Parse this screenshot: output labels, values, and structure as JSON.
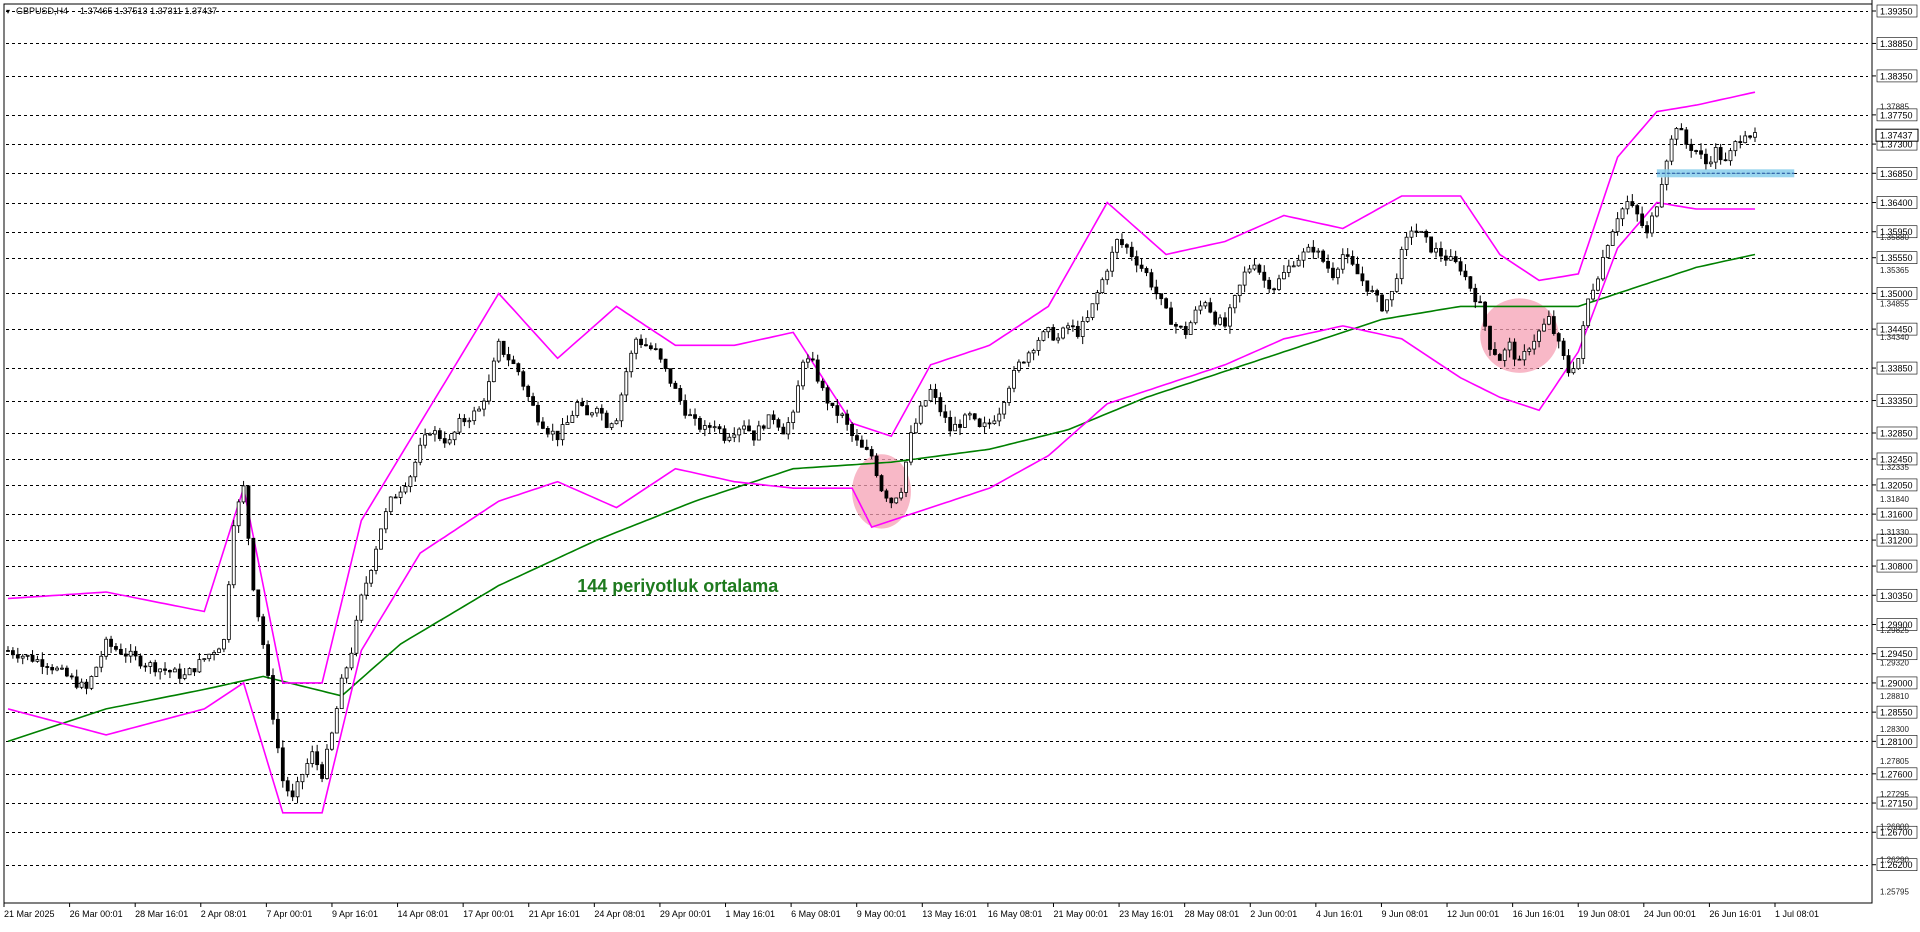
{
  "header": {
    "symbol": "GBPUSD,H4",
    "ohlc": "1.37465 1.37513 1.37311 1.37437"
  },
  "annotation": {
    "ma_label": "144 periyotluk ortalama"
  },
  "colors": {
    "candle": "#000000",
    "bands": "#ff00ff",
    "moving_average": "#008000",
    "highlight_zone": "#f5a0b4",
    "resistance_marker": "#87ceeb",
    "grid": "#000000"
  },
  "chart_data": {
    "type": "candlestick",
    "symbol": "GBPUSD",
    "timeframe": "H4",
    "ylim": [
      1.25795,
      1.3938
    ],
    "price_levels": [
      1.3935,
      1.3885,
      1.3835,
      1.3775,
      1.373,
      1.3685,
      1.364,
      1.3595,
      1.3555,
      1.35,
      1.3445,
      1.3385,
      1.3335,
      1.3285,
      1.3245,
      1.3205,
      1.316,
      1.312,
      1.308,
      1.3035,
      1.299,
      1.2945,
      1.29,
      1.2855,
      1.281,
      1.276,
      1.2715,
      1.267,
      1.262
    ],
    "small_tick_labels": [
      {
        "value": 1.37885,
        "label": "1.37885"
      },
      {
        "value": 1.3588,
        "label": "1.35880"
      },
      {
        "value": 1.35365,
        "label": "1.35365"
      },
      {
        "value": 1.34855,
        "label": "1.34855"
      },
      {
        "value": 1.3434,
        "label": "1.34340"
      },
      {
        "value": 1.32335,
        "label": "1.32335"
      },
      {
        "value": 1.3184,
        "label": "1.31840"
      },
      {
        "value": 1.3133,
        "label": "1.31330"
      },
      {
        "value": 1.29825,
        "label": "1.29825"
      },
      {
        "value": 1.2932,
        "label": "1.29320"
      },
      {
        "value": 1.2881,
        "label": "1.28810"
      },
      {
        "value": 1.283,
        "label": "1.28300"
      },
      {
        "value": 1.27805,
        "label": "1.27805"
      },
      {
        "value": 1.27295,
        "label": "1.27295"
      },
      {
        "value": 1.268,
        "label": "1.26800"
      },
      {
        "value": 1.2629,
        "label": "1.26290"
      },
      {
        "value": 1.25795,
        "label": "1.25795"
      }
    ],
    "current_price": 1.37437,
    "current_price_label": "1.37437",
    "x_labels": [
      "21 Mar 2025",
      "26 Mar 00:01",
      "28 Mar 16:01",
      "2 Apr 08:01",
      "7 Apr 00:01",
      "9 Apr 16:01",
      "14 Apr 08:01",
      "17 Apr 00:01",
      "21 Apr 16:01",
      "24 Apr 08:01",
      "29 Apr 00:01",
      "1 May 16:01",
      "6 May 08:01",
      "9 May 00:01",
      "13 May 16:01",
      "16 May 08:01",
      "21 May 00:01",
      "23 May 16:01",
      "28 May 08:01",
      "2 Jun 00:01",
      "4 Jun 16:01",
      "9 Jun 08:01",
      "12 Jun 00:01",
      "16 Jun 16:01",
      "19 Jun 08:01",
      "24 Jun 00:01",
      "26 Jun 16:01",
      "1 Jul 08:01"
    ],
    "price_path": [
      [
        0,
        1.295
      ],
      [
        4,
        1.293
      ],
      [
        8,
        1.289
      ],
      [
        10,
        1.296
      ],
      [
        14,
        1.293
      ],
      [
        18,
        1.291
      ],
      [
        22,
        1.2965
      ],
      [
        23,
        1.315
      ],
      [
        24,
        1.32
      ],
      [
        25,
        1.305
      ],
      [
        26,
        1.296
      ],
      [
        27,
        1.285
      ],
      [
        28,
        1.275
      ],
      [
        29,
        1.272
      ],
      [
        30,
        1.276
      ],
      [
        31,
        1.279
      ],
      [
        32,
        1.276
      ],
      [
        33,
        1.282
      ],
      [
        34,
        1.29
      ],
      [
        35,
        1.295
      ],
      [
        36,
        1.303
      ],
      [
        37,
        1.308
      ],
      [
        38,
        1.314
      ],
      [
        39,
        1.318
      ],
      [
        40,
        1.32
      ],
      [
        41,
        1.322
      ],
      [
        42,
        1.326
      ],
      [
        43,
        1.329
      ],
      [
        44,
        1.328
      ],
      [
        45,
        1.327
      ],
      [
        46,
        1.33
      ],
      [
        47,
        1.331
      ],
      [
        48,
        1.332
      ],
      [
        49,
        1.336
      ],
      [
        50,
        1.342
      ],
      [
        51,
        1.34
      ],
      [
        52,
        1.338
      ],
      [
        53,
        1.334
      ],
      [
        54,
        1.331
      ],
      [
        55,
        1.329
      ],
      [
        56,
        1.328
      ],
      [
        57,
        1.33
      ],
      [
        58,
        1.333
      ],
      [
        59,
        1.331
      ],
      [
        60,
        1.333
      ],
      [
        61,
        1.33
      ],
      [
        62,
        1.331
      ],
      [
        63,
        1.338
      ],
      [
        64,
        1.343
      ],
      [
        65,
        1.342
      ],
      [
        66,
        1.341
      ],
      [
        67,
        1.338
      ],
      [
        68,
        1.335
      ],
      [
        69,
        1.332
      ],
      [
        70,
        1.33
      ],
      [
        71,
        1.329
      ],
      [
        72,
        1.33
      ],
      [
        73,
        1.328
      ],
      [
        74,
        1.329
      ],
      [
        75,
        1.33
      ],
      [
        76,
        1.328
      ],
      [
        77,
        1.33
      ],
      [
        78,
        1.331
      ],
      [
        79,
        1.329
      ],
      [
        80,
        1.331
      ],
      [
        81,
        1.34
      ],
      [
        82,
        1.339
      ],
      [
        83,
        1.335
      ],
      [
        84,
        1.332
      ],
      [
        85,
        1.331
      ],
      [
        86,
        1.328
      ],
      [
        87,
        1.326
      ],
      [
        88,
        1.325
      ],
      [
        89,
        1.32
      ],
      [
        90,
        1.318
      ],
      [
        91,
        1.32
      ],
      [
        92,
        1.328
      ],
      [
        93,
        1.332
      ],
      [
        94,
        1.335
      ],
      [
        95,
        1.332
      ],
      [
        96,
        1.329
      ],
      [
        97,
        1.33
      ],
      [
        98,
        1.331
      ],
      [
        99,
        1.329
      ],
      [
        100,
        1.33
      ],
      [
        101,
        1.332
      ],
      [
        102,
        1.336
      ],
      [
        103,
        1.339
      ],
      [
        104,
        1.341
      ],
      [
        105,
        1.343
      ],
      [
        106,
        1.344
      ],
      [
        107,
        1.343
      ],
      [
        108,
        1.345
      ],
      [
        109,
        1.344
      ],
      [
        110,
        1.346
      ],
      [
        111,
        1.35
      ],
      [
        112,
        1.354
      ],
      [
        113,
        1.358
      ],
      [
        114,
        1.357
      ],
      [
        115,
        1.355
      ],
      [
        116,
        1.353
      ],
      [
        117,
        1.35
      ],
      [
        118,
        1.347
      ],
      [
        119,
        1.345
      ],
      [
        120,
        1.344
      ],
      [
        121,
        1.347
      ],
      [
        122,
        1.349
      ],
      [
        123,
        1.346
      ],
      [
        124,
        1.345
      ],
      [
        125,
        1.349
      ],
      [
        126,
        1.353
      ],
      [
        127,
        1.355
      ],
      [
        128,
        1.352
      ],
      [
        129,
        1.351
      ],
      [
        130,
        1.353
      ],
      [
        131,
        1.355
      ],
      [
        132,
        1.356
      ],
      [
        133,
        1.357
      ],
      [
        134,
        1.355
      ],
      [
        135,
        1.353
      ],
      [
        136,
        1.356
      ],
      [
        137,
        1.354
      ],
      [
        138,
        1.352
      ],
      [
        139,
        1.35
      ],
      [
        140,
        1.348
      ],
      [
        141,
        1.35
      ],
      [
        142,
        1.356
      ],
      [
        143,
        1.36
      ],
      [
        144,
        1.359
      ],
      [
        145,
        1.357
      ],
      [
        146,
        1.356
      ],
      [
        147,
        1.355
      ],
      [
        148,
        1.354
      ],
      [
        149,
        1.351
      ],
      [
        150,
        1.348
      ],
      [
        151,
        1.342
      ],
      [
        152,
        1.34
      ],
      [
        153,
        1.342
      ],
      [
        154,
        1.339
      ],
      [
        155,
        1.342
      ],
      [
        156,
        1.344
      ],
      [
        157,
        1.346
      ],
      [
        158,
        1.342
      ],
      [
        159,
        1.338
      ],
      [
        160,
        1.34
      ],
      [
        161,
        1.349
      ],
      [
        162,
        1.353
      ],
      [
        163,
        1.358
      ],
      [
        164,
        1.362
      ],
      [
        165,
        1.364
      ],
      [
        166,
        1.362
      ],
      [
        167,
        1.359
      ],
      [
        168,
        1.364
      ],
      [
        169,
        1.371
      ],
      [
        170,
        1.376
      ],
      [
        171,
        1.373
      ],
      [
        172,
        1.372
      ],
      [
        173,
        1.37
      ],
      [
        174,
        1.372
      ],
      [
        175,
        1.37
      ],
      [
        176,
        1.373
      ],
      [
        177,
        1.375
      ],
      [
        178,
        1.374
      ]
    ],
    "price_path_note": "",
    "moving_average": {
      "name": "",
      "points": [
        [
          0,
          1.281
        ],
        [
          10,
          1.286
        ],
        [
          20,
          1.289
        ],
        [
          26,
          1.291
        ],
        [
          34,
          1.288
        ],
        [
          40,
          1.296
        ],
        [
          50,
          1.305
        ],
        [
          60,
          1.312
        ],
        [
          70,
          1.318
        ],
        [
          80,
          1.323
        ],
        [
          90,
          1.324
        ],
        [
          100,
          1.326
        ],
        [
          108,
          1.329
        ],
        [
          116,
          1.334
        ],
        [
          124,
          1.338
        ],
        [
          132,
          1.342
        ],
        [
          140,
          1.346
        ],
        [
          148,
          1.348
        ],
        [
          154,
          1.348
        ],
        [
          160,
          1.348
        ],
        [
          166,
          1.351
        ],
        [
          172,
          1.354
        ],
        [
          178,
          1.356
        ]
      ]
    },
    "upper_band": {
      "points": [
        [
          0,
          1.303
        ],
        [
          10,
          1.304
        ],
        [
          20,
          1.301
        ],
        [
          24,
          1.32
        ],
        [
          28,
          1.29
        ],
        [
          32,
          1.29
        ],
        [
          36,
          1.315
        ],
        [
          42,
          1.33
        ],
        [
          50,
          1.35
        ],
        [
          56,
          1.34
        ],
        [
          62,
          1.348
        ],
        [
          68,
          1.342
        ],
        [
          74,
          1.342
        ],
        [
          80,
          1.344
        ],
        [
          86,
          1.33
        ],
        [
          90,
          1.328
        ],
        [
          94,
          1.339
        ],
        [
          100,
          1.342
        ],
        [
          106,
          1.348
        ],
        [
          112,
          1.364
        ],
        [
          118,
          1.356
        ],
        [
          124,
          1.358
        ],
        [
          130,
          1.362
        ],
        [
          136,
          1.36
        ],
        [
          142,
          1.365
        ],
        [
          148,
          1.365
        ],
        [
          152,
          1.356
        ],
        [
          156,
          1.352
        ],
        [
          160,
          1.353
        ],
        [
          164,
          1.371
        ],
        [
          168,
          1.378
        ],
        [
          172,
          1.379
        ],
        [
          178,
          1.381
        ]
      ]
    },
    "lower_band": {
      "points": [
        [
          0,
          1.286
        ],
        [
          10,
          1.282
        ],
        [
          20,
          1.286
        ],
        [
          24,
          1.29
        ],
        [
          28,
          1.27
        ],
        [
          32,
          1.27
        ],
        [
          36,
          1.295
        ],
        [
          42,
          1.31
        ],
        [
          50,
          1.318
        ],
        [
          56,
          1.321
        ],
        [
          62,
          1.317
        ],
        [
          68,
          1.323
        ],
        [
          74,
          1.321
        ],
        [
          80,
          1.32
        ],
        [
          86,
          1.32
        ],
        [
          88,
          1.314
        ],
        [
          92,
          1.316
        ],
        [
          100,
          1.32
        ],
        [
          106,
          1.325
        ],
        [
          112,
          1.333
        ],
        [
          118,
          1.336
        ],
        [
          124,
          1.339
        ],
        [
          130,
          1.343
        ],
        [
          136,
          1.345
        ],
        [
          142,
          1.343
        ],
        [
          148,
          1.337
        ],
        [
          152,
          1.334
        ],
        [
          156,
          1.332
        ],
        [
          160,
          1.341
        ],
        [
          164,
          1.357
        ],
        [
          168,
          1.364
        ],
        [
          172,
          1.363
        ],
        [
          178,
          1.363
        ]
      ]
    },
    "highlight_zones": [
      {
        "x_from": 86,
        "x_to": 92,
        "price_from": 1.315,
        "price_to": 1.324
      },
      {
        "x_from": 150,
        "x_to": 158,
        "price_from": 1.339,
        "price_to": 1.348
      }
    ],
    "resistance_marker": {
      "x_from": 168,
      "x_to": 182,
      "price": 1.3685
    },
    "ma_label_anchor": {
      "x": 58,
      "price": 1.304
    }
  }
}
